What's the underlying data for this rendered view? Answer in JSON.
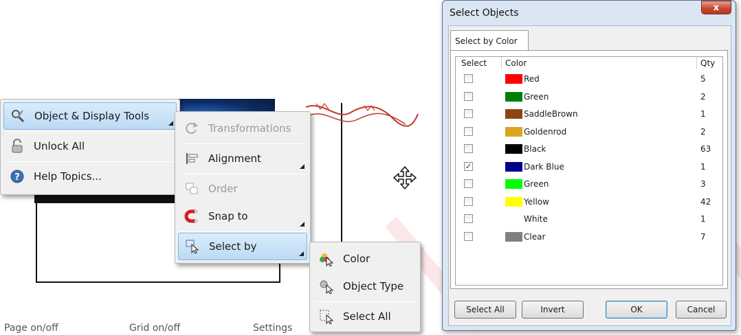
{
  "context_menu": {
    "items": [
      {
        "label": "Object & Display Tools",
        "icon": "tools-icon",
        "highlighted": true,
        "submenu": true
      },
      {
        "label": "Unlock All",
        "icon": "unlock-icon"
      },
      {
        "label": "Help Topics...",
        "icon": "help-icon"
      }
    ]
  },
  "tools_submenu": {
    "items": [
      {
        "label": "Transformations",
        "icon": "transform-icon",
        "disabled": true
      },
      {
        "label": "Alignment",
        "icon": "alignment-icon",
        "submenu": true
      },
      {
        "label": "Order",
        "icon": "order-icon",
        "disabled": true
      },
      {
        "label": "Snap to",
        "icon": "magnet-icon",
        "submenu": true
      },
      {
        "label": "Select by",
        "icon": "select-by-icon",
        "highlighted": true,
        "submenu": true
      }
    ]
  },
  "select_by_submenu": {
    "items": [
      {
        "label": "Color",
        "icon": "color-select-icon"
      },
      {
        "label": "Object Type",
        "icon": "object-type-icon"
      },
      {
        "label": "Select All",
        "icon": "select-all-icon"
      }
    ]
  },
  "status_bar": {
    "page_toggle": "Page on/off",
    "grid_toggle": "Grid on/off",
    "settings": "Settings"
  },
  "dialog": {
    "title": "Select Objects",
    "close_glyph": "x",
    "tab_label": "Select by Color",
    "columns": {
      "select": "Select",
      "color": "Color",
      "qty": "Qty"
    },
    "rows": [
      {
        "name": "Red",
        "swatch": "#ff0000",
        "qty": "5",
        "checked": false
      },
      {
        "name": "Green",
        "swatch": "#008000",
        "qty": "2",
        "checked": false
      },
      {
        "name": "SaddleBrown",
        "swatch": "#8b4513",
        "qty": "1",
        "checked": false
      },
      {
        "name": "Goldenrod",
        "swatch": "#daa520",
        "qty": "2",
        "checked": false
      },
      {
        "name": "Black",
        "swatch": "#000000",
        "qty": "63",
        "checked": false
      },
      {
        "name": "Dark Blue",
        "swatch": "#00008b",
        "qty": "1",
        "checked": true
      },
      {
        "name": "Green",
        "swatch": "#00ff00",
        "qty": "3",
        "checked": false
      },
      {
        "name": "Yellow",
        "swatch": "#ffff00",
        "qty": "42",
        "checked": false
      },
      {
        "name": "White",
        "swatch": "#ffffff",
        "qty": "1",
        "checked": false
      },
      {
        "name": "Clear",
        "swatch": "#808080",
        "qty": "7",
        "checked": false
      }
    ],
    "buttons": {
      "select_all": "Select All",
      "invert": "Invert",
      "ok": "OK",
      "cancel": "Cancel"
    }
  },
  "colors": {
    "menu_highlight": "#bcdaf5",
    "watermark": "#dc3c3c"
  }
}
